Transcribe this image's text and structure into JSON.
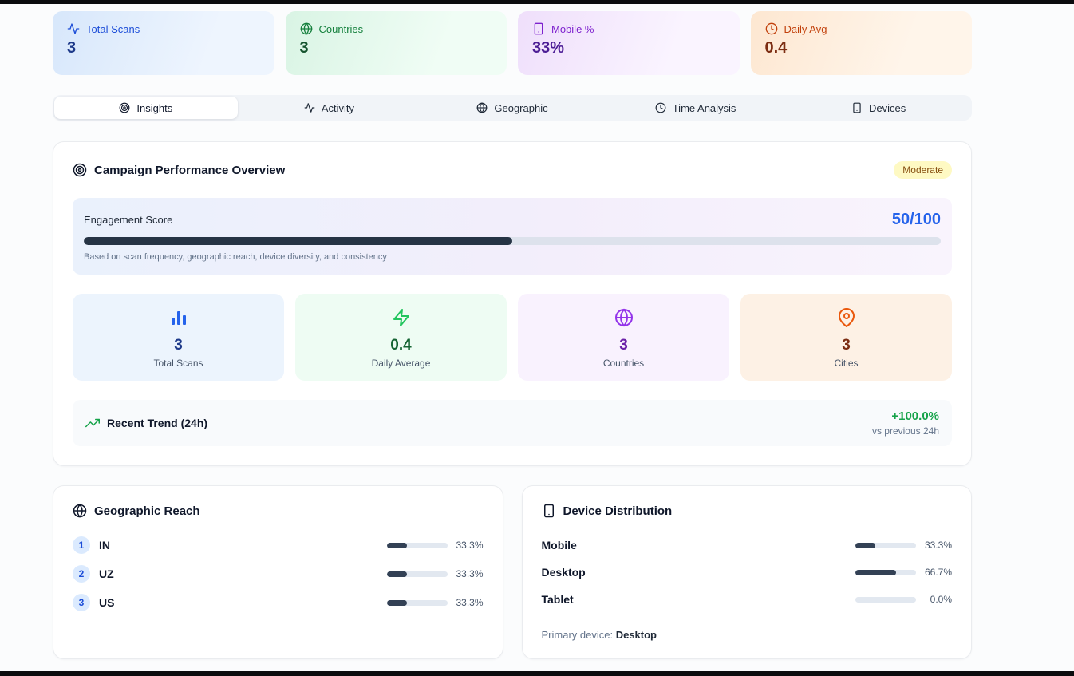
{
  "stats": [
    {
      "label": "Total Scans",
      "value": "3",
      "icon": "activity-icon",
      "accent": "#1d4ed8"
    },
    {
      "label": "Countries",
      "value": "3",
      "icon": "globe-icon",
      "accent": "#15803d"
    },
    {
      "label": "Mobile %",
      "value": "33%",
      "icon": "smartphone-icon",
      "accent": "#7e22ce"
    },
    {
      "label": "Daily Avg",
      "value": "0.4",
      "icon": "clock-icon",
      "accent": "#c2410c"
    }
  ],
  "tabs": [
    {
      "label": "Insights",
      "icon": "target-icon",
      "active": true
    },
    {
      "label": "Activity",
      "icon": "activity-icon",
      "active": false
    },
    {
      "label": "Geographic",
      "icon": "globe-icon",
      "active": false
    },
    {
      "label": "Time Analysis",
      "icon": "clock-icon",
      "active": false
    },
    {
      "label": "Devices",
      "icon": "smartphone-icon",
      "active": false
    }
  ],
  "overview": {
    "title": "Campaign Performance Overview",
    "badge": "Moderate",
    "badge_color": "#fef9c3",
    "engagement": {
      "label": "Engagement Score",
      "score": "50/100",
      "percent": 50,
      "caption": "Based on scan frequency, geographic reach, device diversity, and consistency",
      "fill_color": "#263445",
      "score_color": "#2563eb"
    },
    "mini_stats": [
      {
        "value": "3",
        "label": "Total Scans",
        "icon": "bar-chart-icon",
        "accent": "#2563eb"
      },
      {
        "value": "0.4",
        "label": "Daily Average",
        "icon": "zap-icon",
        "accent": "#22c55e"
      },
      {
        "value": "3",
        "label": "Countries",
        "icon": "globe-icon",
        "accent": "#9333ea"
      },
      {
        "value": "3",
        "label": "Cities",
        "icon": "map-pin-icon",
        "accent": "#ea580c"
      }
    ],
    "trend": {
      "label": "Recent Trend (24h)",
      "value": "+100.0%",
      "caption": "vs previous 24h",
      "value_color": "#16a34a"
    }
  },
  "geographic": {
    "title": "Geographic Reach",
    "rows": [
      {
        "rank": "1",
        "code": "IN",
        "percent": 33.3,
        "pct_label": "33.3%"
      },
      {
        "rank": "2",
        "code": "UZ",
        "percent": 33.3,
        "pct_label": "33.3%"
      },
      {
        "rank": "3",
        "code": "US",
        "percent": 33.3,
        "pct_label": "33.3%"
      }
    ]
  },
  "devices": {
    "title": "Device Distribution",
    "rows": [
      {
        "name": "Mobile",
        "percent": 33.3,
        "pct_label": "33.3%"
      },
      {
        "name": "Desktop",
        "percent": 66.7,
        "pct_label": "66.7%"
      },
      {
        "name": "Tablet",
        "percent": 0,
        "pct_label": "0.0%"
      }
    ],
    "footer_label": "Primary device:",
    "footer_value": "Desktop"
  }
}
